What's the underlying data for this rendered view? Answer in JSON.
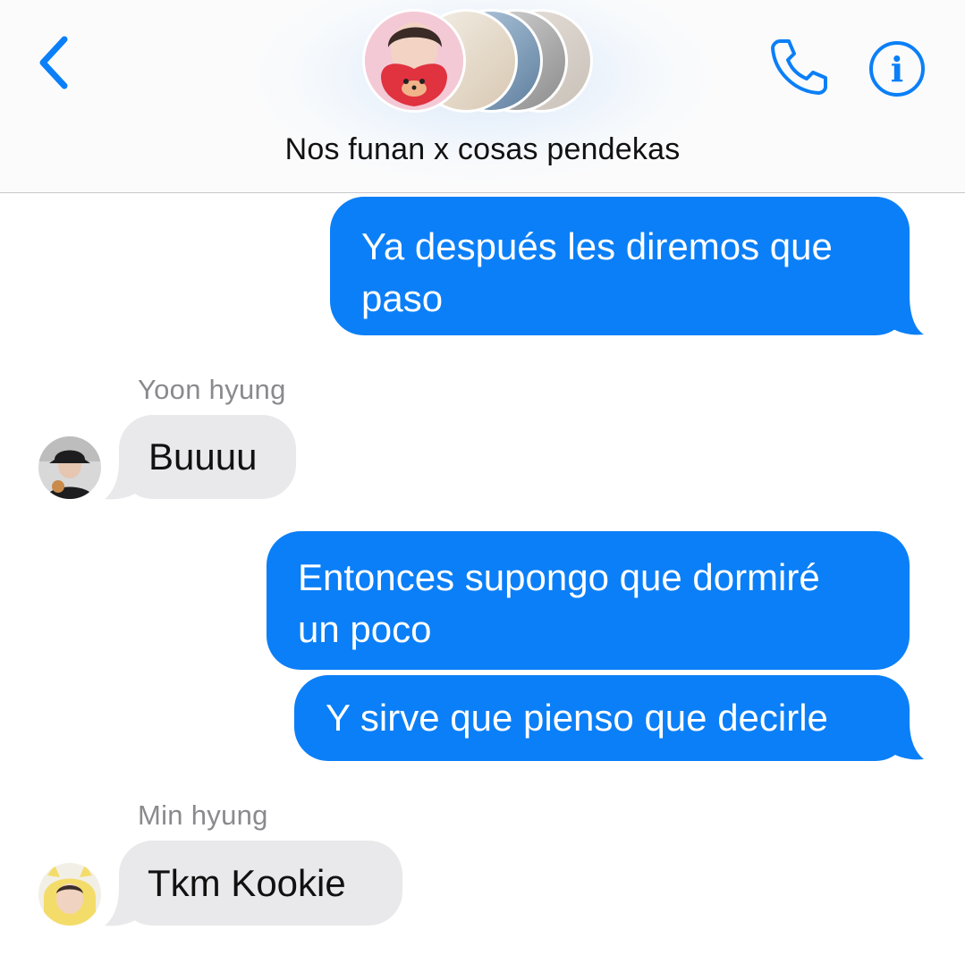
{
  "header": {
    "title": "Nos funan x cosas pendekas",
    "back_icon": "chevron-left-icon",
    "call_icon": "phone-icon",
    "info_icon": "info-icon",
    "info_glyph": "i",
    "accent_color": "#0b7ff7",
    "group_avatars": [
      "member-avatar-1",
      "member-avatar-2",
      "member-avatar-3",
      "member-avatar-4",
      "member-avatar-5"
    ]
  },
  "messages": [
    {
      "direction": "outgoing",
      "lines": [
        "Ya después les diremos que",
        "paso"
      ]
    },
    {
      "direction": "incoming",
      "sender": "Yoon hyung",
      "lines": [
        "Buuuu"
      ]
    },
    {
      "direction": "outgoing",
      "lines": [
        "Entonces supongo que dormiré",
        "un poco"
      ]
    },
    {
      "direction": "outgoing",
      "lines": [
        "Y sirve que pienso que decirle"
      ]
    },
    {
      "direction": "incoming",
      "sender": "Min hyung",
      "lines": [
        "Tkm Kookie"
      ]
    }
  ],
  "colors": {
    "outgoing_bubble": "#0b7ff7",
    "incoming_bubble": "#e9e9eb",
    "sender_name": "#8a8a8e"
  }
}
